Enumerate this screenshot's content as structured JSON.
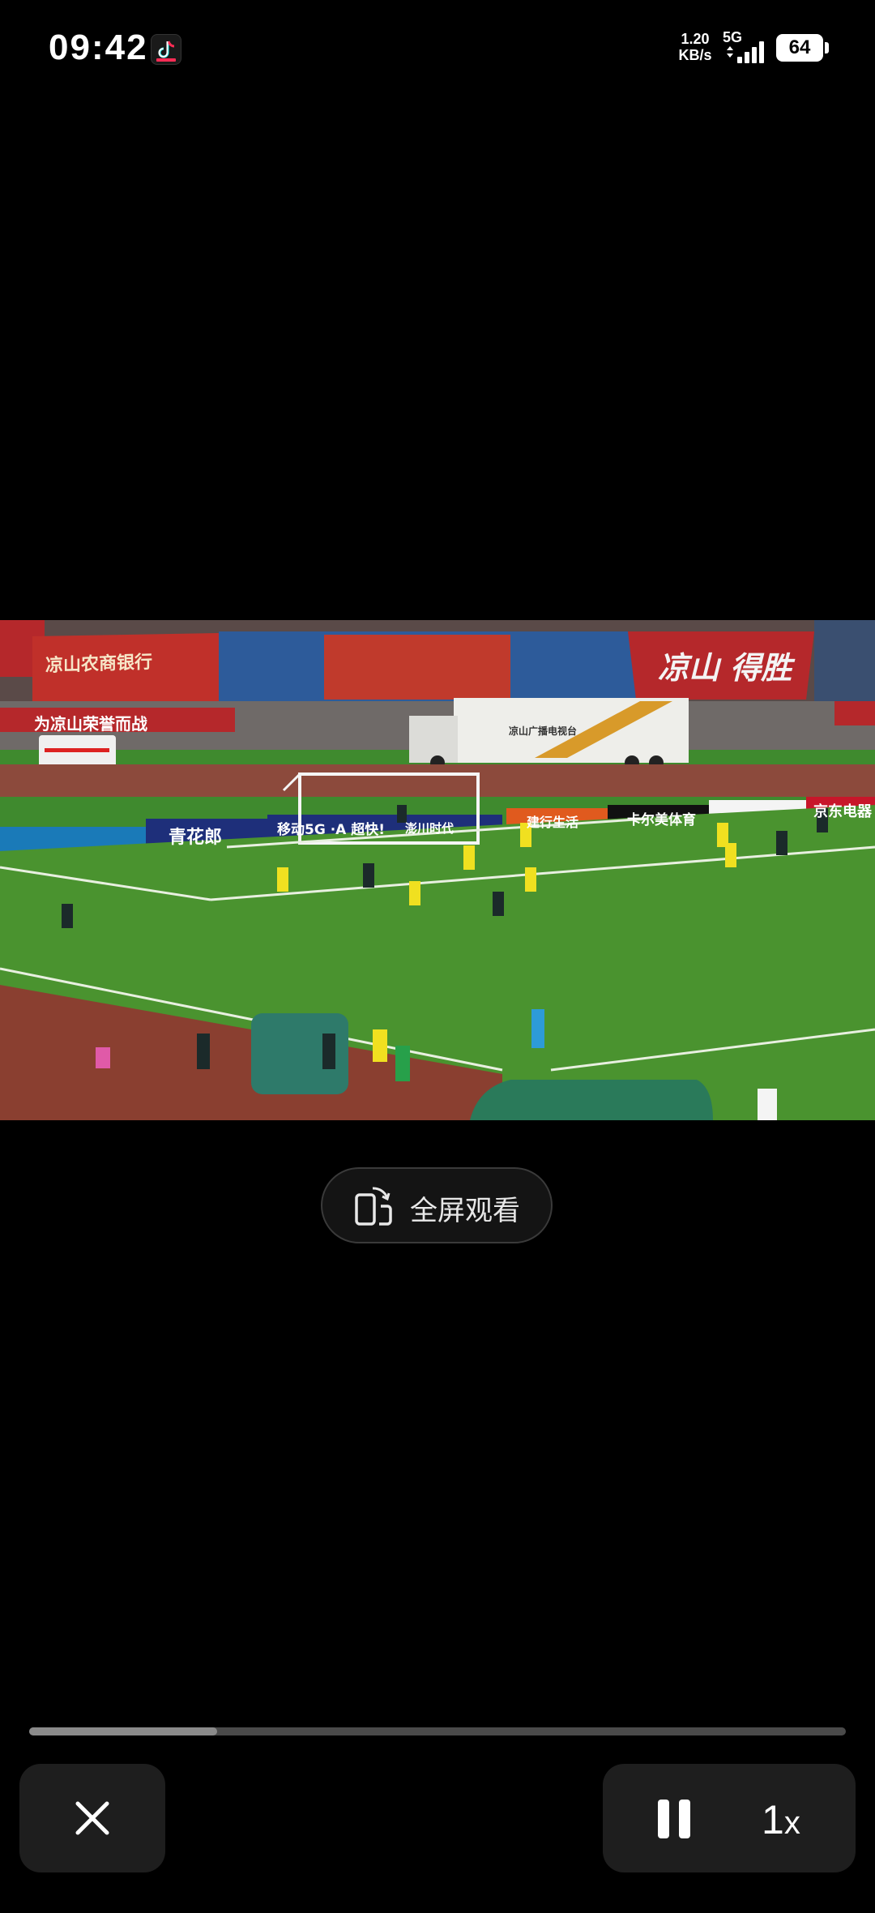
{
  "status_bar": {
    "time": "09:42",
    "app_icon": "tiktok-icon",
    "net_speed_value": "1.20",
    "net_speed_unit": "KB/s",
    "network_type": "5G",
    "signal_icon": "signal-bars-icon",
    "battery_level": "64"
  },
  "video": {
    "banners": {
      "bank": "凉山农商银行",
      "slogan": "为凉山荣誉而战",
      "stand_right": "凉山 得胜",
      "ad_qinghualang": "青花郎",
      "ad_mobile": "移动5G ·A 超快!",
      "ad_kappa": "卡尔美体育",
      "ad_jd": "京东电器",
      "ad_jianxing": "建行生活",
      "ad_pengchuan": "澎川时代",
      "ad_tv": "凉山广播电视台"
    },
    "progress_fraction": 0.23
  },
  "fullscreen": {
    "icon": "rotate-phone-icon",
    "label": "全屏观看"
  },
  "controls": {
    "close_icon": "close-icon",
    "pause_icon": "pause-icon",
    "speed_value": "1",
    "speed_suffix": "x"
  },
  "colors": {
    "background": "#000000",
    "pitch": "#3f8a2e",
    "banner_red": "#b5282b",
    "control_bg": "#1e1e1e"
  }
}
